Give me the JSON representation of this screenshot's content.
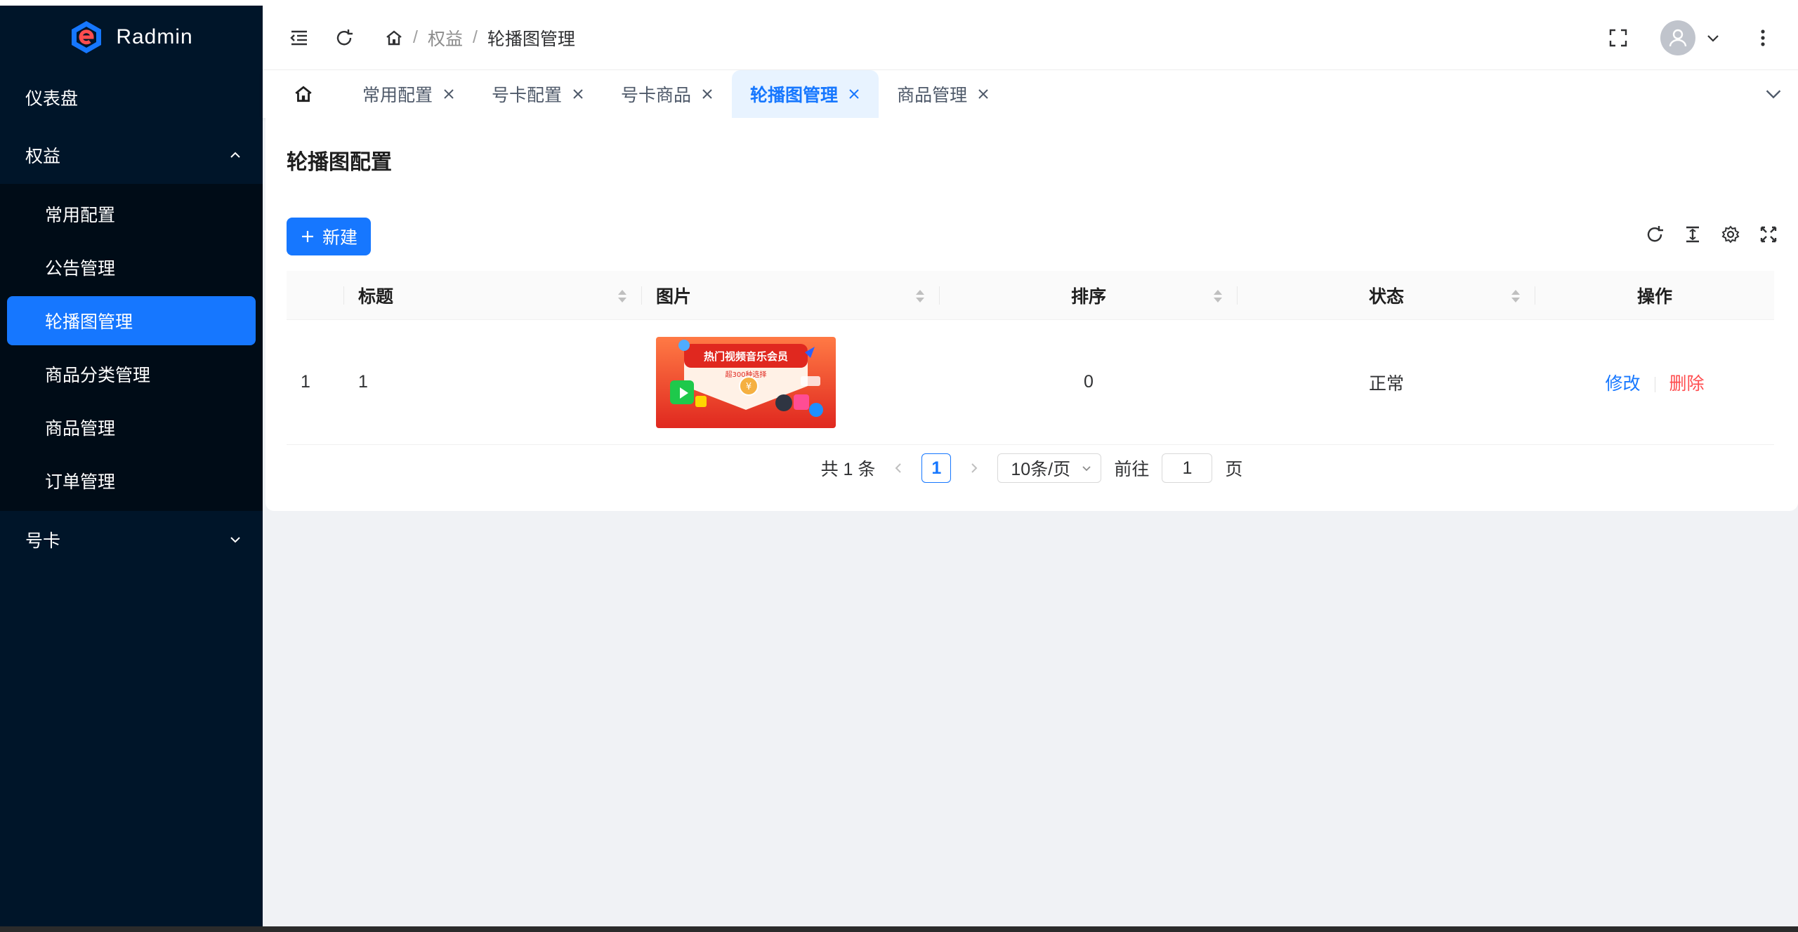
{
  "brand": {
    "name": "Radmin",
    "colors": {
      "primary": "#1677ff",
      "sidebar": "#001529",
      "danger": "#ff4d4f"
    }
  },
  "sidebar": {
    "items": [
      {
        "label": "仪表盘",
        "icon": "none"
      },
      {
        "label": "权益",
        "icon": "chevron-up-icon",
        "expanded": true,
        "children": [
          {
            "label": "常用配置"
          },
          {
            "label": "公告管理"
          },
          {
            "label": "轮播图管理",
            "active": true
          },
          {
            "label": "商品分类管理"
          },
          {
            "label": "商品管理"
          },
          {
            "label": "订单管理"
          }
        ]
      },
      {
        "label": "号卡",
        "icon": "chevron-down-icon",
        "expanded": false
      }
    ]
  },
  "header": {
    "breadcrumb": {
      "level1": "权益",
      "level2": "轮播图管理",
      "separator": "/"
    }
  },
  "tabs": [
    {
      "label": "常用配置"
    },
    {
      "label": "号卡配置"
    },
    {
      "label": "号卡商品"
    },
    {
      "label": "轮播图管理",
      "active": true
    },
    {
      "label": "商品管理"
    }
  ],
  "page": {
    "title": "轮播图配置",
    "new_button": "新建",
    "table": {
      "columns": [
        "标题",
        "图片",
        "排序",
        "状态",
        "操作"
      ],
      "rows": [
        {
          "index": "1",
          "title": "1",
          "image_text": "热门视频音乐会员",
          "image_subtext": "超300种选择",
          "sort": "0",
          "status": "正常"
        }
      ],
      "actions": {
        "edit": "修改",
        "delete": "删除"
      }
    },
    "pagination": {
      "total_text": "共 1 条",
      "current_page": "1",
      "page_size": "10条/页",
      "goto_prefix": "前往",
      "goto_value": "1",
      "goto_suffix": "页"
    }
  }
}
